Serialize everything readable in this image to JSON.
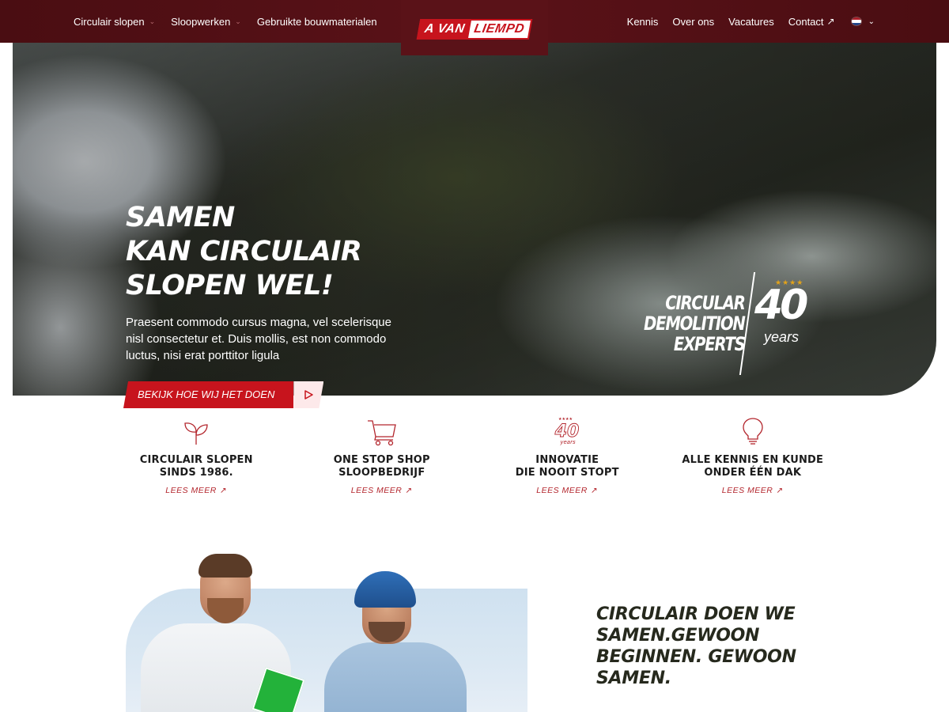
{
  "header": {
    "nav_left": [
      {
        "label": "Circulair slopen",
        "has_dropdown": true
      },
      {
        "label": "Sloopwerken",
        "has_dropdown": true
      },
      {
        "label": "Gebruikte bouwmaterialen",
        "has_dropdown": false
      }
    ],
    "logo": {
      "part1": "A VAN",
      "part2": "LIEMPD"
    },
    "nav_right": {
      "kennis": "Kennis",
      "over_ons": "Over ons",
      "vacatures": "Vacatures",
      "contact": "Contact",
      "language_icon": "netherlands-flag-icon"
    }
  },
  "hero": {
    "title_lines": [
      "SAMEN",
      "KAN CIRCULAIR",
      "SLOPEN WEL!"
    ],
    "text": "Praesent commodo cursus magna, vel scelerisque nisl consectetur et. Duis mollis, est non commodo luctus, nisi erat porttitor ligula",
    "badge": {
      "line1": "CIRCULAR",
      "line2": "DEMOLITION",
      "line3": "EXPERTS",
      "number": "40",
      "unit": "years",
      "stars": "★★★★"
    },
    "cta": {
      "label": "BEKIJK HOE WIJ HET DOEN",
      "icon": "play-icon"
    }
  },
  "features": [
    {
      "icon": "sprout-icon",
      "title_line1": "CIRCULAIR SLOPEN",
      "title_line2": "SINDS 1986.",
      "link": "LEES MEER"
    },
    {
      "icon": "cart-icon",
      "title_line1": "ONE STOP SHOP",
      "title_line2": "SLOOPBEDRIJF",
      "link": "LEES MEER"
    },
    {
      "icon": "forty-years-icon",
      "icon_text": "40",
      "icon_sub": "years",
      "title_line1": "INNOVATIE",
      "title_line2": "DIE NOOIT STOPT",
      "link": "LEES MEER"
    },
    {
      "icon": "lightbulb-icon",
      "title_line1": "ALLE KENNIS EN KUNDE",
      "title_line2": "ONDER ÉÉN DAK",
      "link": "LEES MEER"
    }
  ],
  "claim": {
    "lines": [
      "CIRCULAIR DOEN WE",
      "SAMEN.GEWOON",
      "BEGINNEN. GEWOON",
      "SAMEN."
    ]
  },
  "colors": {
    "brand_red": "#c7141d",
    "header_bg": "#4a0d12",
    "claim_text": "#26291d"
  }
}
